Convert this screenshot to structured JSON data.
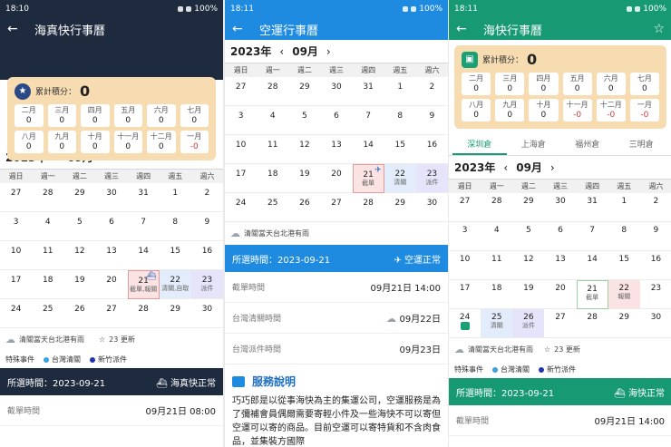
{
  "weekdays": [
    "週日",
    "週一",
    "週二",
    "週三",
    "週四",
    "週五",
    "週六"
  ],
  "phone1": {
    "status_time": "18:10",
    "battery": "100%",
    "title": "海真快行事曆",
    "score_label": "累計積分：",
    "score_value": "0",
    "months": [
      {
        "m": "二月",
        "v": "0"
      },
      {
        "m": "三月",
        "v": "0"
      },
      {
        "m": "四月",
        "v": "0"
      },
      {
        "m": "五月",
        "v": "0"
      },
      {
        "m": "六月",
        "v": "0"
      },
      {
        "m": "七月",
        "v": "0"
      },
      {
        "m": "八月",
        "v": "0"
      },
      {
        "m": "九月",
        "v": "0"
      },
      {
        "m": "十月",
        "v": "0"
      },
      {
        "m": "十一月",
        "v": "0"
      },
      {
        "m": "十二月",
        "v": "0"
      },
      {
        "m": "一月",
        "v": "-0"
      }
    ],
    "year": "2023年",
    "month": "09月",
    "days": [
      {
        "n": "27"
      },
      {
        "n": "28"
      },
      {
        "n": "29"
      },
      {
        "n": "30"
      },
      {
        "n": "31"
      },
      {
        "n": "1"
      },
      {
        "n": "2"
      },
      {
        "n": "3"
      },
      {
        "n": "4"
      },
      {
        "n": "5"
      },
      {
        "n": "6"
      },
      {
        "n": "7"
      },
      {
        "n": "8"
      },
      {
        "n": "9"
      },
      {
        "n": "10"
      },
      {
        "n": "11"
      },
      {
        "n": "12"
      },
      {
        "n": "13"
      },
      {
        "n": "14"
      },
      {
        "n": "15"
      },
      {
        "n": "16"
      },
      {
        "n": "17"
      },
      {
        "n": "18"
      },
      {
        "n": "19"
      },
      {
        "n": "20"
      },
      {
        "n": "21",
        "note": "截單,報關",
        "hl": "hl-red hl-sel",
        "ship": "⛴"
      },
      {
        "n": "22",
        "note": "清關,自取",
        "hl": "hl-blue"
      },
      {
        "n": "23",
        "note": "派件",
        "hl": "hl-purple"
      },
      {
        "n": "24"
      },
      {
        "n": "25"
      },
      {
        "n": "26"
      },
      {
        "n": "27"
      },
      {
        "n": "28"
      },
      {
        "n": "29"
      },
      {
        "n": "30"
      }
    ],
    "weather": "清關當天台北港有雨",
    "updates": "23 更新",
    "legend_special": "特殊事件",
    "legend_a": "台灣清關",
    "legend_b": "新竹派件",
    "sel_date": "所選時間：2023-09-21",
    "sel_status": "海真快正常",
    "cutoff_label": "截單時間",
    "cutoff_value": "09月21日 08:00"
  },
  "phone2": {
    "status_time": "18:11",
    "battery": "100%",
    "title": "空運行事曆",
    "year": "2023年",
    "month": "09月",
    "days": [
      {
        "n": "27"
      },
      {
        "n": "28"
      },
      {
        "n": "29"
      },
      {
        "n": "30"
      },
      {
        "n": "31"
      },
      {
        "n": "1"
      },
      {
        "n": "2"
      },
      {
        "n": "3"
      },
      {
        "n": "4"
      },
      {
        "n": "5"
      },
      {
        "n": "6"
      },
      {
        "n": "7"
      },
      {
        "n": "8"
      },
      {
        "n": "9"
      },
      {
        "n": "10"
      },
      {
        "n": "11"
      },
      {
        "n": "12"
      },
      {
        "n": "13"
      },
      {
        "n": "14"
      },
      {
        "n": "15"
      },
      {
        "n": "16"
      },
      {
        "n": "17"
      },
      {
        "n": "18"
      },
      {
        "n": "19"
      },
      {
        "n": "20"
      },
      {
        "n": "21",
        "note": "截單",
        "hl": "hl-red hl-sel",
        "ship": "✈"
      },
      {
        "n": "22",
        "note": "清關",
        "hl": "hl-blue"
      },
      {
        "n": "23",
        "note": "派件",
        "hl": "hl-purple"
      },
      {
        "n": "24"
      },
      {
        "n": "25"
      },
      {
        "n": "26"
      },
      {
        "n": "27"
      },
      {
        "n": "28"
      },
      {
        "n": "29"
      },
      {
        "n": "30"
      }
    ],
    "weather": "清關當天台北港有雨",
    "sel_date": "所選時間：2023-09-21",
    "sel_status": "空運正常",
    "rows": [
      {
        "label": "截單時間",
        "value": "09月21日 14:00"
      },
      {
        "label": "台灣清關時間",
        "value": "09月22日"
      },
      {
        "label": "台灣派件時間",
        "value": "09月23日"
      }
    ],
    "svc_title": "服務說明",
    "svc_text": "巧巧郎是以從事海快為主的集運公司，空運服務是為了彌補會員偶爾需要寄輕小件及一些海快不可以寄但空運可以寄的商品。目前空運可以寄特貨和不含肉食品，並集裝方國際"
  },
  "phone3": {
    "status_time": "18:11",
    "battery": "100%",
    "title": "海快行事曆",
    "score_label": "累計積分：",
    "score_value": "0",
    "months": [
      {
        "m": "二月",
        "v": "0"
      },
      {
        "m": "三月",
        "v": "0"
      },
      {
        "m": "四月",
        "v": "0"
      },
      {
        "m": "五月",
        "v": "0"
      },
      {
        "m": "六月",
        "v": "0"
      },
      {
        "m": "七月",
        "v": "0"
      },
      {
        "m": "八月",
        "v": "0"
      },
      {
        "m": "九月",
        "v": "0"
      },
      {
        "m": "十月",
        "v": "0"
      },
      {
        "m": "十一月",
        "v": "-0"
      },
      {
        "m": "十二月",
        "v": "-0"
      },
      {
        "m": "一月",
        "v": "-0"
      }
    ],
    "tabs": [
      "深圳倉",
      "上海倉",
      "福州倉",
      "三明倉"
    ],
    "year": "2023年",
    "month": "09月",
    "days": [
      {
        "n": "27"
      },
      {
        "n": "28"
      },
      {
        "n": "29"
      },
      {
        "n": "30"
      },
      {
        "n": "31"
      },
      {
        "n": "1"
      },
      {
        "n": "2"
      },
      {
        "n": "3"
      },
      {
        "n": "4"
      },
      {
        "n": "5"
      },
      {
        "n": "6"
      },
      {
        "n": "7"
      },
      {
        "n": "8"
      },
      {
        "n": "9"
      },
      {
        "n": "10"
      },
      {
        "n": "11"
      },
      {
        "n": "12"
      },
      {
        "n": "13"
      },
      {
        "n": "14"
      },
      {
        "n": "15"
      },
      {
        "n": "16"
      },
      {
        "n": "17"
      },
      {
        "n": "18"
      },
      {
        "n": "19"
      },
      {
        "n": "20"
      },
      {
        "n": "21",
        "note": "截單",
        "hl": "hl-green"
      },
      {
        "n": "22",
        "note": "報關",
        "hl": "hl-red"
      },
      {
        "n": "23"
      },
      {
        "n": "24",
        "tag": true
      },
      {
        "n": "25",
        "note": "清關",
        "hl": "hl-blue"
      },
      {
        "n": "26",
        "note": "派件",
        "hl": "hl-purple"
      },
      {
        "n": "27"
      },
      {
        "n": "28"
      },
      {
        "n": "29"
      },
      {
        "n": "30"
      }
    ],
    "weather": "清關當天台北港有雨",
    "updates": "23 更新",
    "legend_special": "特殊事件",
    "legend_a": "台灣清關",
    "legend_b": "新竹派件",
    "sel_date": "所選時間：2023-09-21",
    "sel_status": "海快正常",
    "cutoff_label": "截單時間",
    "cutoff_value": "09月21日 14:00"
  }
}
